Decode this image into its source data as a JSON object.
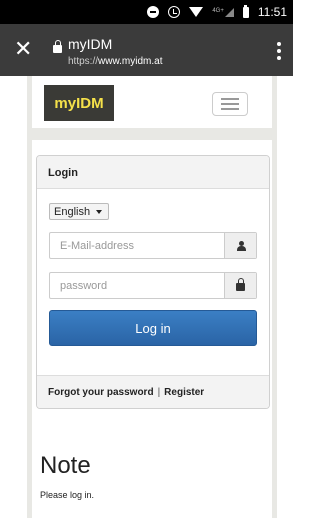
{
  "status_bar": {
    "network": "4G+",
    "time": "11:51"
  },
  "browser": {
    "title": "myIDM",
    "url_scheme": "https://",
    "url_host": "www.myidm.at"
  },
  "site": {
    "logo_text": "myIDM",
    "logo_bg": "#3a3a36",
    "logo_color": "#f5e14a"
  },
  "login_panel": {
    "heading": "Login",
    "language": "English",
    "email_placeholder": "E-Mail-address",
    "password_placeholder": "password",
    "login_button": "Log in",
    "forgot_link": "Forgot your password",
    "separator": "|",
    "register_link": "Register",
    "button_color": "#2d6fb5"
  },
  "note": {
    "title": "Note",
    "text": "Please log in."
  }
}
